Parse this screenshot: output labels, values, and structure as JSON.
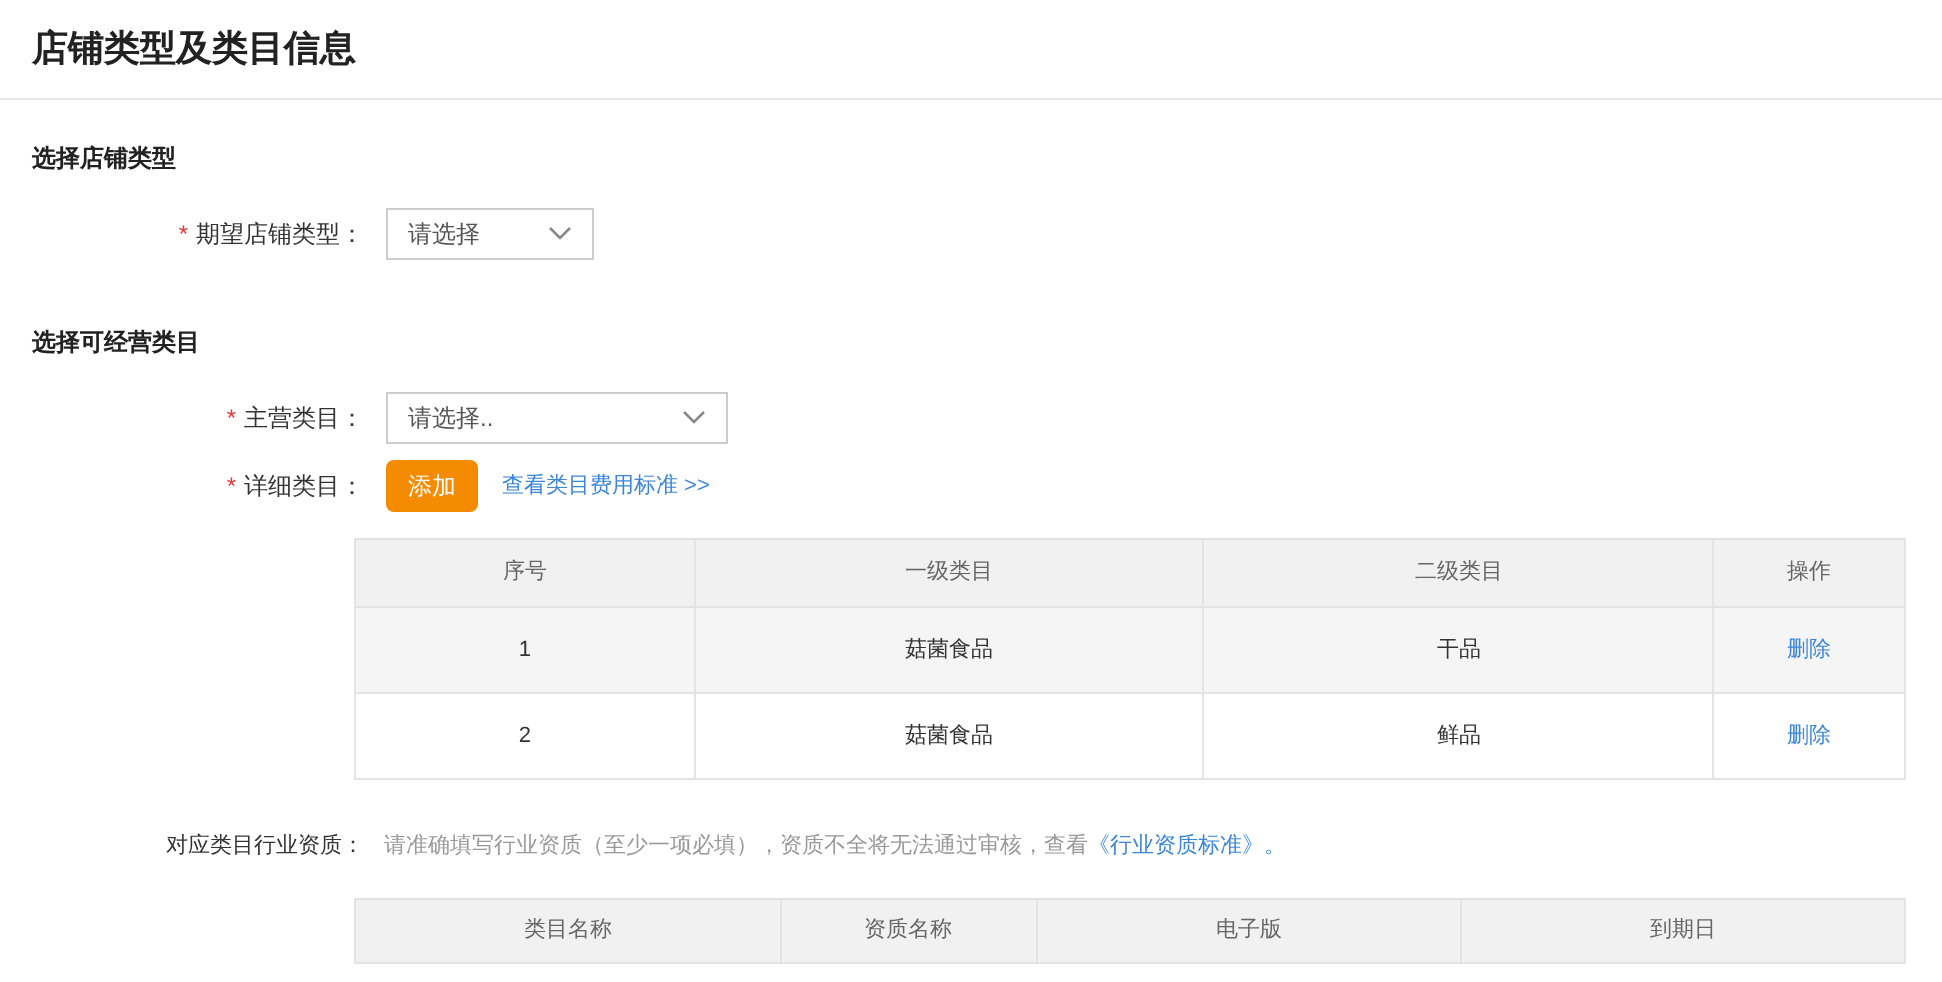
{
  "page_title": "店铺类型及类目信息",
  "store_type_section": {
    "heading": "选择店铺类型",
    "field": {
      "required_mark": "*",
      "label": "期望店铺类型：",
      "placeholder": "请选择"
    }
  },
  "category_section": {
    "heading": "选择可经营类目",
    "main_category": {
      "required_mark": "*",
      "label": "主营类目：",
      "placeholder": "请选择.."
    },
    "detail_category": {
      "required_mark": "*",
      "label": "详细类目：",
      "add_button": "添加",
      "fee_link": "查看类目费用标准 >>"
    },
    "table": {
      "columns": [
        "序号",
        "一级类目",
        "二级类目",
        "操作"
      ],
      "rows": [
        {
          "cells": [
            "1",
            "菇菌食品",
            "干品"
          ],
          "action": "删除"
        },
        {
          "cells": [
            "2",
            "菇菌食品",
            "鲜品"
          ],
          "action": "删除"
        }
      ]
    }
  },
  "qualification": {
    "label": "对应类目行业资质：",
    "hint": "请准确填写行业资质（至少一项必填），资质不全将无法通过审核，查看",
    "link": "《行业资质标准》",
    "hint_end": "。",
    "table": {
      "columns": [
        "类目名称",
        "资质名称",
        "电子版",
        "到期日"
      ]
    }
  }
}
